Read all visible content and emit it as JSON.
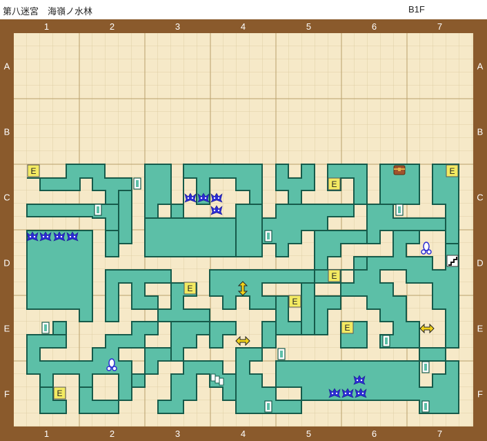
{
  "header": {
    "title": "第八迷宮　海嶺ノ水林",
    "floor": "B1F"
  },
  "grid": {
    "columns": [
      "1",
      "2",
      "3",
      "4",
      "5",
      "6",
      "7"
    ],
    "rows": [
      "A",
      "B",
      "C",
      "D",
      "E",
      "F"
    ]
  },
  "legend_icons": {
    "encounter_tile": "E",
    "icons": [
      "treasure-chest-icon",
      "stairs-icon",
      "door-icon",
      "fish-monster-icon",
      "current-vertical-icon",
      "current-horizontal-icon",
      "flower-icon"
    ]
  },
  "colors": {
    "frame": "#8a5a2c",
    "floor": "#f6e9c8",
    "wall_fill": "#5cbfa7",
    "wall_edge": "#155a4a",
    "grid_line": "#d7c294",
    "encounter": "#f3ea62",
    "monster": "#2b2bd4"
  }
}
